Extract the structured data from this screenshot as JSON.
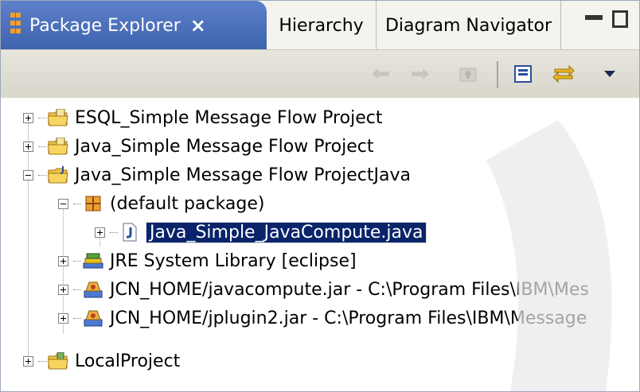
{
  "tabs": {
    "active": {
      "label": "Package Explorer",
      "icon": "package-explorer-icon",
      "close": "×"
    },
    "hierarchy": {
      "label": "Hierarchy"
    },
    "diagram_navigator": {
      "label": "Diagram Navigator"
    }
  },
  "window_controls": {
    "minimize": "minimize-icon",
    "maximize": "maximize-icon"
  },
  "toolbar": {
    "buttons": [
      "back-icon",
      "forward-icon",
      "up-icon",
      "collapse-all-icon",
      "link-with-editor-icon",
      "view-menu-icon"
    ]
  },
  "tree": [
    {
      "label": "ESQL_Simple Message Flow Project",
      "icon": "project-folder-icon",
      "expanded": false
    },
    {
      "label": "Java_Simple Message Flow Project",
      "icon": "project-folder-icon",
      "expanded": false
    },
    {
      "label": "Java_Simple Message Flow ProjectJava",
      "icon": "java-project-icon",
      "expanded": true
    },
    {
      "label": "(default package)",
      "icon": "package-icon",
      "expanded": true
    },
    {
      "label": "Java_Simple_JavaCompute.java",
      "icon": "java-file-icon",
      "expanded": false,
      "selected": true
    },
    {
      "label": "JRE System Library [eclipse]",
      "icon": "library-icon",
      "expanded": false
    },
    {
      "label": "JCN_HOME/javacompute.jar - C:\\Program Files\\IBM\\Mes",
      "icon": "jar-icon",
      "expanded": false
    },
    {
      "label": "JCN_HOME/jplugin2.jar - C:\\Program Files\\IBM\\Message",
      "icon": "jar-icon",
      "expanded": false
    },
    {
      "label": "LocalProject",
      "icon": "project-folder-icon",
      "expanded": false
    }
  ],
  "colors": {
    "selection": "#0a246a",
    "active_tab": "#4a6fbb",
    "folder": "#f0c040"
  }
}
